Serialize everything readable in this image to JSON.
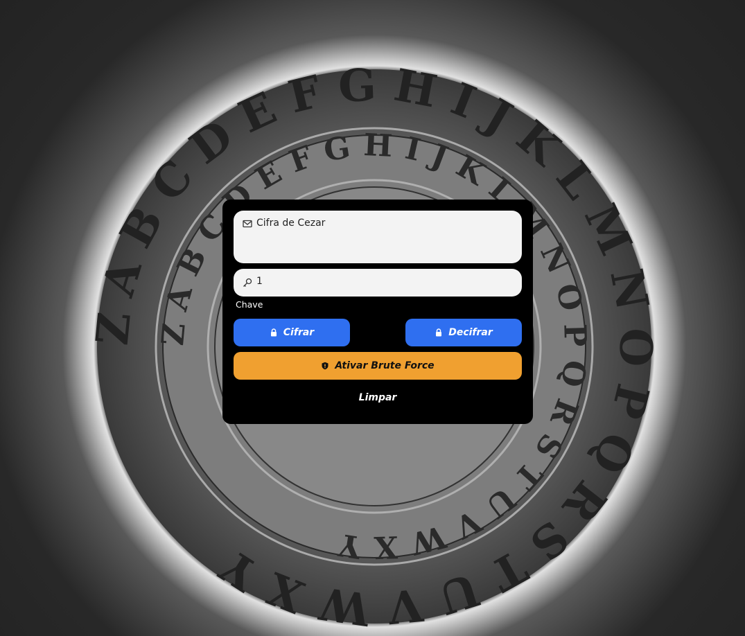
{
  "message": {
    "value": "Cifra de Cezar",
    "icon": "mail-icon"
  },
  "key": {
    "value": "1",
    "icon": "key-icon",
    "label": "Chave"
  },
  "buttons": {
    "cifrar": "Cifrar",
    "decifrar": "Decifrar",
    "brute_force": "Ativar Brute Force",
    "limpar": "Limpar"
  },
  "colors": {
    "blue": "#2f6ff0",
    "orange": "#f0a030",
    "card": "#000000"
  },
  "background": {
    "outer_ring": "ZABCDEFGHIJKLMNOPQRSTUVWXY",
    "inner_ring": "ZABCDEFGHIJKLMNOPQRSTUVWXY"
  }
}
